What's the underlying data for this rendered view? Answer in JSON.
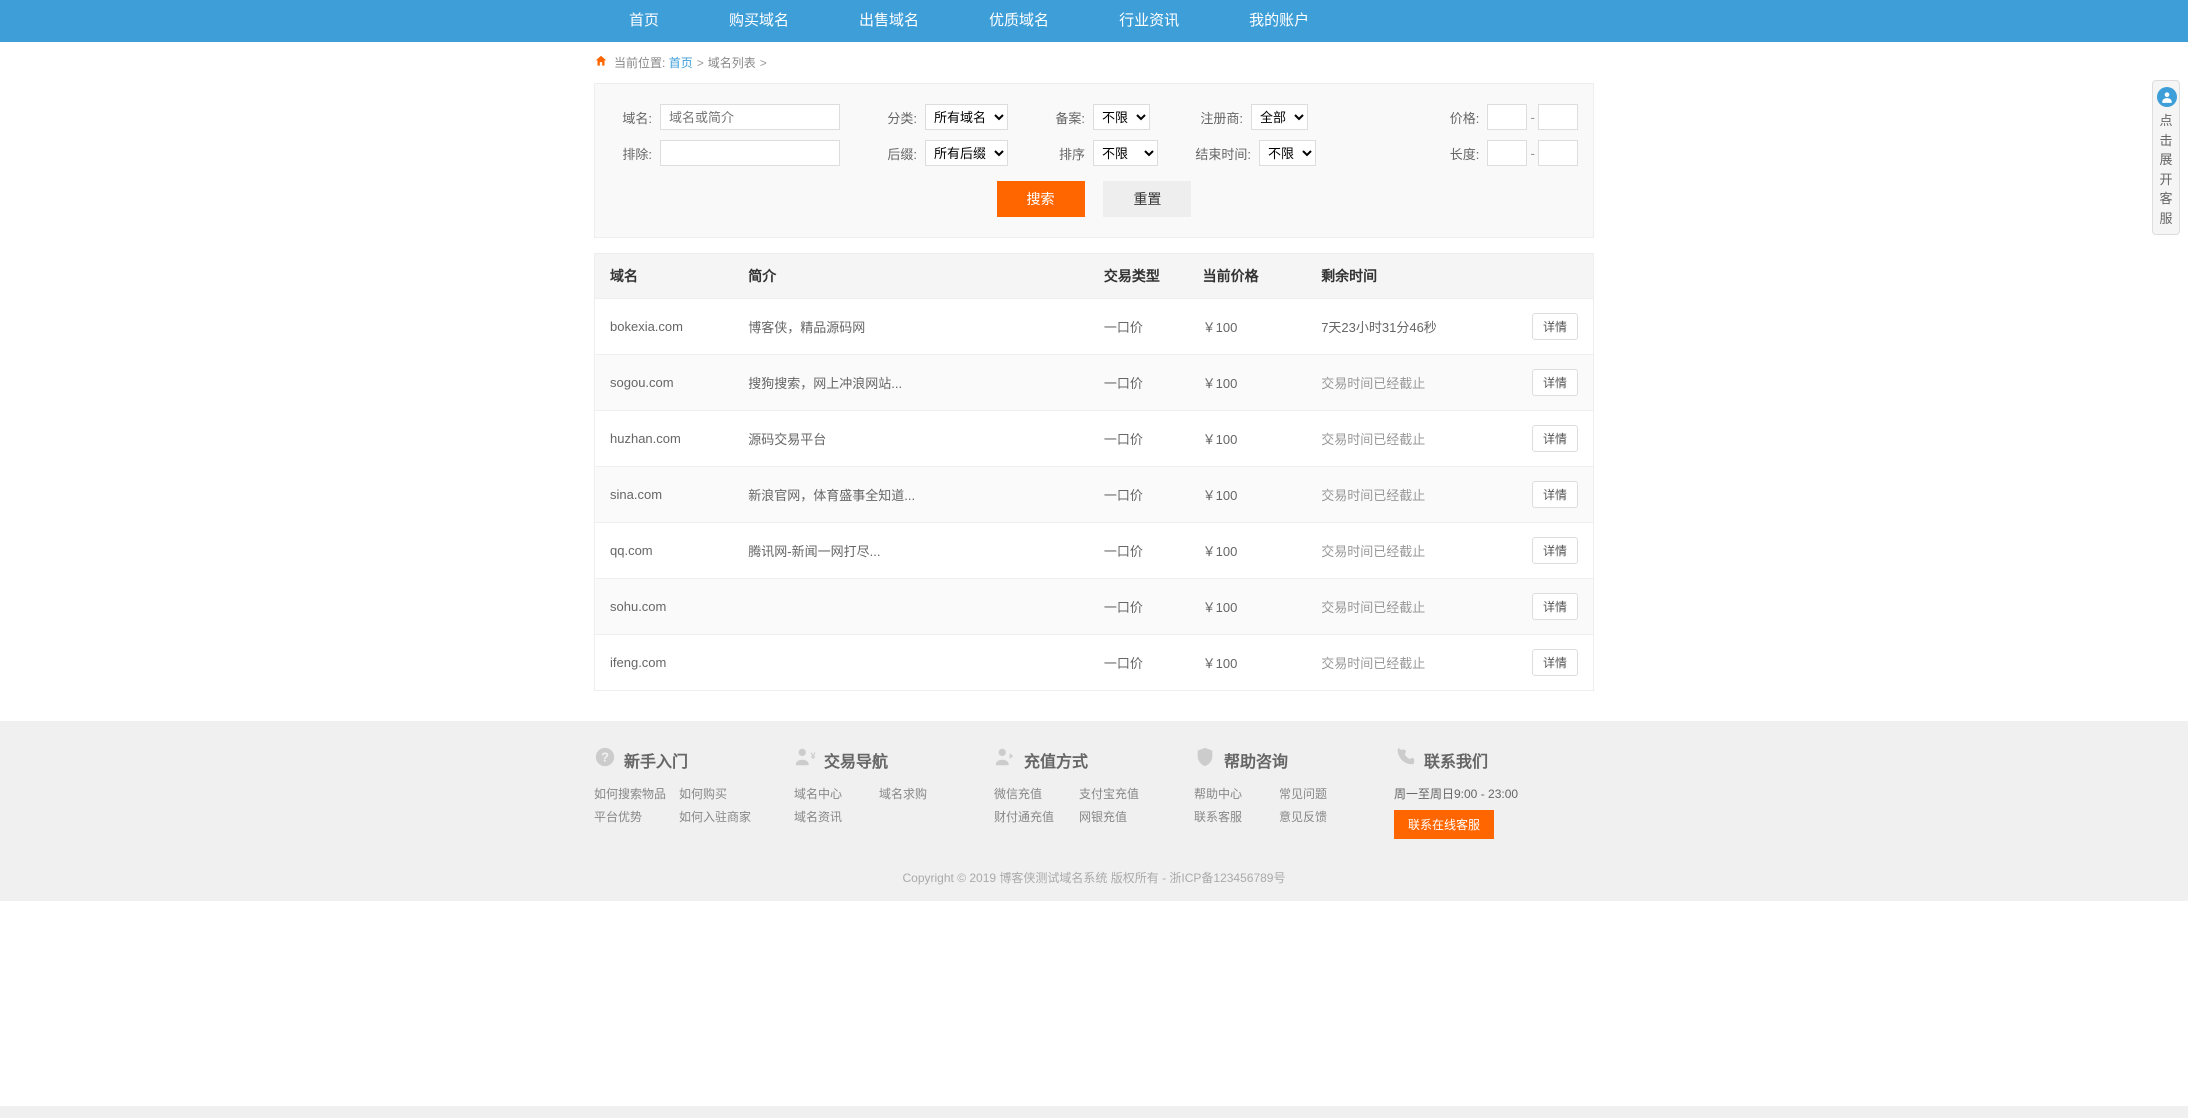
{
  "nav": {
    "items": [
      "首页",
      "购买域名",
      "出售域名",
      "优质域名",
      "行业资讯",
      "我的账户"
    ]
  },
  "breadcrumb": {
    "label": "当前位置:",
    "home": "首页",
    "current": "域名列表"
  },
  "filters": {
    "domain_label": "域名:",
    "domain_placeholder": "域名或简介",
    "exclude_label": "排除:",
    "category_label": "分类:",
    "category_value": "所有域名",
    "suffix_label": "后缀:",
    "suffix_value": "所有后缀",
    "beian_label": "备案:",
    "beian_value": "不限",
    "sort_label": "排序",
    "sort_value": "不限",
    "registrar_label": "注册商:",
    "registrar_value": "全部",
    "endtime_label": "结束时间:",
    "endtime_value": "不限",
    "price_label": "价格:",
    "length_label": "长度:",
    "search_btn": "搜索",
    "reset_btn": "重置"
  },
  "table": {
    "headers": {
      "domain": "域名",
      "desc": "简介",
      "type": "交易类型",
      "price": "当前价格",
      "time": "剩余时间"
    },
    "detail_btn": "详情",
    "rows": [
      {
        "domain": "bokexia.com",
        "desc": "博客侠，精品源码网",
        "type": "一口价",
        "price": "￥100",
        "time": "7天23小时31分46秒",
        "expired": false
      },
      {
        "domain": "sogou.com",
        "desc": "搜狗搜索，网上冲浪网站...",
        "type": "一口价",
        "price": "￥100",
        "time": "交易时间已经截止",
        "expired": true
      },
      {
        "domain": "huzhan.com",
        "desc": "源码交易平台",
        "type": "一口价",
        "price": "￥100",
        "time": "交易时间已经截止",
        "expired": true
      },
      {
        "domain": "sina.com",
        "desc": "新浪官网，体育盛事全知道...",
        "type": "一口价",
        "price": "￥100",
        "time": "交易时间已经截止",
        "expired": true
      },
      {
        "domain": "qq.com",
        "desc": "腾讯网-新闻一网打尽...",
        "type": "一口价",
        "price": "￥100",
        "time": "交易时间已经截止",
        "expired": true
      },
      {
        "domain": "sohu.com",
        "desc": "",
        "type": "一口价",
        "price": "￥100",
        "time": "交易时间已经截止",
        "expired": true
      },
      {
        "domain": "ifeng.com",
        "desc": "",
        "type": "一口价",
        "price": "￥100",
        "time": "交易时间已经截止",
        "expired": true
      }
    ]
  },
  "footer": {
    "cols": [
      {
        "title": "新手入门",
        "icon": "question",
        "links": [
          "如何搜索物品",
          "如何购买",
          "平台优势",
          "如何入驻商家"
        ]
      },
      {
        "title": "交易导航",
        "icon": "person-yen",
        "links": [
          "域名中心",
          "域名求购",
          "域名资讯"
        ]
      },
      {
        "title": "充值方式",
        "icon": "person-arrow",
        "links": [
          "微信充值",
          "支付宝充值",
          "财付通充值",
          "网银充值"
        ]
      },
      {
        "title": "帮助咨询",
        "icon": "shield",
        "links": [
          "帮助中心",
          "常见问题",
          "联系客服",
          "意见反馈"
        ]
      }
    ],
    "contact": {
      "title": "联系我们",
      "hours": "周一至周日9:00 - 23:00",
      "btn": "联系在线客服"
    }
  },
  "copyright": {
    "text": "Copyright © 2019 博客侠测试域名系统 版权所有 - ",
    "icp": "浙ICP备123456789号"
  },
  "side": {
    "text": "点击展开客服"
  }
}
